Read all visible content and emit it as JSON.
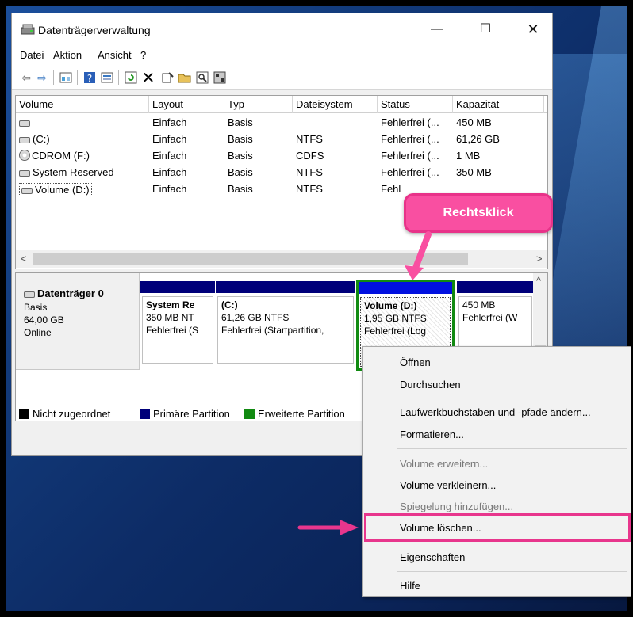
{
  "window": {
    "title": "Datenträgerverwaltung",
    "minimize_glyph": "—",
    "maximize_glyph": "☐",
    "close_glyph": "✕"
  },
  "menu": [
    "Datei",
    "Aktion",
    "Ansicht",
    "?"
  ],
  "toolbar_icons": [
    "back-icon",
    "forward-icon",
    "list-view-icon",
    "help-icon",
    "properties-icon",
    "refresh-icon",
    "delete-icon",
    "settings-icon",
    "open-icon",
    "search-icon",
    "disk-icon"
  ],
  "volume_list": {
    "columns": [
      "Volume",
      "Layout",
      "Typ",
      "Dateisystem",
      "Status",
      "Kapazität"
    ],
    "rows": [
      {
        "volume": "",
        "layout": "Einfach",
        "typ": "Basis",
        "fs": "",
        "status": "Fehlerfrei (...",
        "kap": "450 MB",
        "icon": "disk"
      },
      {
        "volume": "(C:)",
        "layout": "Einfach",
        "typ": "Basis",
        "fs": "NTFS",
        "status": "Fehlerfrei (...",
        "kap": "61,26 GB",
        "icon": "disk"
      },
      {
        "volume": "CDROM (F:)",
        "layout": "Einfach",
        "typ": "Basis",
        "fs": "CDFS",
        "status": "Fehlerfrei (...",
        "kap": "1 MB",
        "icon": "cd"
      },
      {
        "volume": "System Reserved",
        "layout": "Einfach",
        "typ": "Basis",
        "fs": "NTFS",
        "status": "Fehlerfrei (...",
        "kap": "350 MB",
        "icon": "disk"
      },
      {
        "volume": "Volume (D:)",
        "layout": "Einfach",
        "typ": "Basis",
        "fs": "NTFS",
        "status": "Fehl",
        "kap": "",
        "icon": "disk"
      }
    ]
  },
  "disk": {
    "name": "Datenträger 0",
    "type": "Basis",
    "size": "64,00 GB",
    "state": "Online",
    "partitions": [
      {
        "name": "System Re",
        "size": "350 MB NT",
        "status": "Fehlerfrei (S"
      },
      {
        "name": "(C:)",
        "size": "61,26 GB NTFS",
        "status": "Fehlerfrei (Startpartition,"
      },
      {
        "name": "Volume  (D:)",
        "size": "1,95 GB NTFS",
        "status": "Fehlerfrei (Log"
      },
      {
        "name": "",
        "size": "450 MB",
        "status": "Fehlerfrei (W"
      }
    ]
  },
  "legend": [
    {
      "label": "Nicht zugeordnet",
      "color": "#000000"
    },
    {
      "label": "Primäre Partition",
      "color": "#00007a"
    },
    {
      "label": "Erweiterte Partition",
      "color": "#118a11"
    }
  ],
  "context_menu": {
    "items": [
      {
        "label": "Öffnen",
        "disabled": false
      },
      {
        "label": "Durchsuchen",
        "disabled": false
      },
      {
        "label": "Laufwerkbuchstaben und -pfade ändern...",
        "disabled": false
      },
      {
        "label": "Formatieren...",
        "disabled": false
      },
      {
        "label": "Volume erweitern...",
        "disabled": true
      },
      {
        "label": "Volume verkleinern...",
        "disabled": false
      },
      {
        "label": "Spiegelung hinzufügen...",
        "disabled": true
      },
      {
        "label": "Volume löschen...",
        "disabled": false
      },
      {
        "label": "Eigenschaften",
        "disabled": false
      },
      {
        "label": "Hilfe",
        "disabled": false
      }
    ]
  },
  "annotation": {
    "callout_text": "Rechtsklick",
    "accent_color": "#f94fa1"
  }
}
